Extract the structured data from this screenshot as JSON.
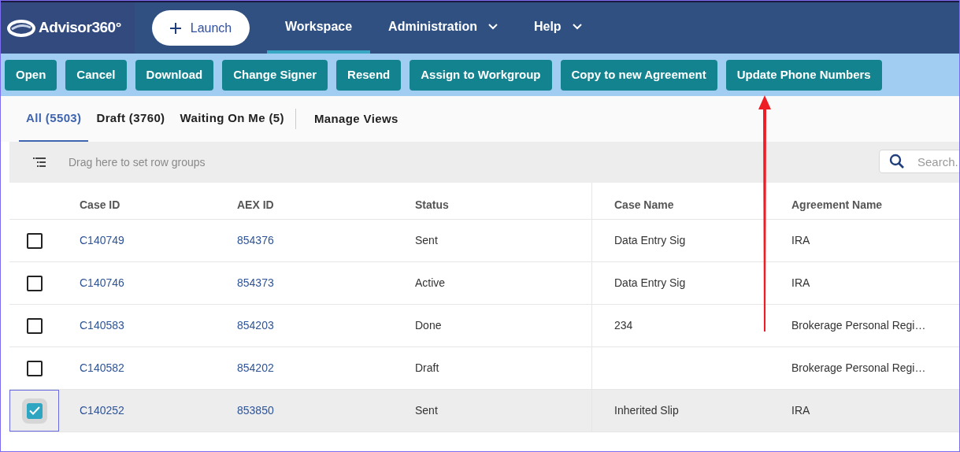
{
  "nav": {
    "logo": "Advisor360°",
    "launch": "Launch",
    "items": [
      {
        "label": "Workspace",
        "selected": true,
        "has_menu": false
      },
      {
        "label": "Administration",
        "selected": false,
        "has_menu": true
      },
      {
        "label": "Help",
        "selected": false,
        "has_menu": true
      }
    ]
  },
  "actions": [
    "Open",
    "Cancel",
    "Download",
    "Change Signer",
    "Resend",
    "Assign to Workgroup",
    "Copy to new Agreement",
    "Update Phone Numbers"
  ],
  "tabs": [
    {
      "label": "All (5503)",
      "selected": true
    },
    {
      "label": "Draft (3760)",
      "selected": false
    },
    {
      "label": "Waiting On Me (5)",
      "selected": false
    }
  ],
  "manage_views": "Manage Views",
  "group_panel": {
    "hint": "Drag here to set row groups"
  },
  "search": {
    "placeholder": "Search."
  },
  "table": {
    "columns": [
      "Case ID",
      "AEX ID",
      "Status",
      "Case Name",
      "Agreement Name"
    ],
    "rows": [
      {
        "selected": false,
        "cells": [
          "C140749",
          "854376",
          "Sent",
          "Data Entry Sig",
          "IRA"
        ]
      },
      {
        "selected": false,
        "cells": [
          "C140746",
          "854373",
          "Active",
          "Data Entry Sig",
          "IRA"
        ]
      },
      {
        "selected": false,
        "cells": [
          "C140583",
          "854203",
          "Done",
          "234",
          "Brokerage Personal Regi…"
        ]
      },
      {
        "selected": false,
        "cells": [
          "C140582",
          "854202",
          "Draft",
          "",
          "Brokerage Personal Regi…"
        ]
      },
      {
        "selected": true,
        "cells": [
          "C140252",
          "853850",
          "Sent",
          "Inherited Slip",
          "IRA"
        ]
      }
    ]
  }
}
